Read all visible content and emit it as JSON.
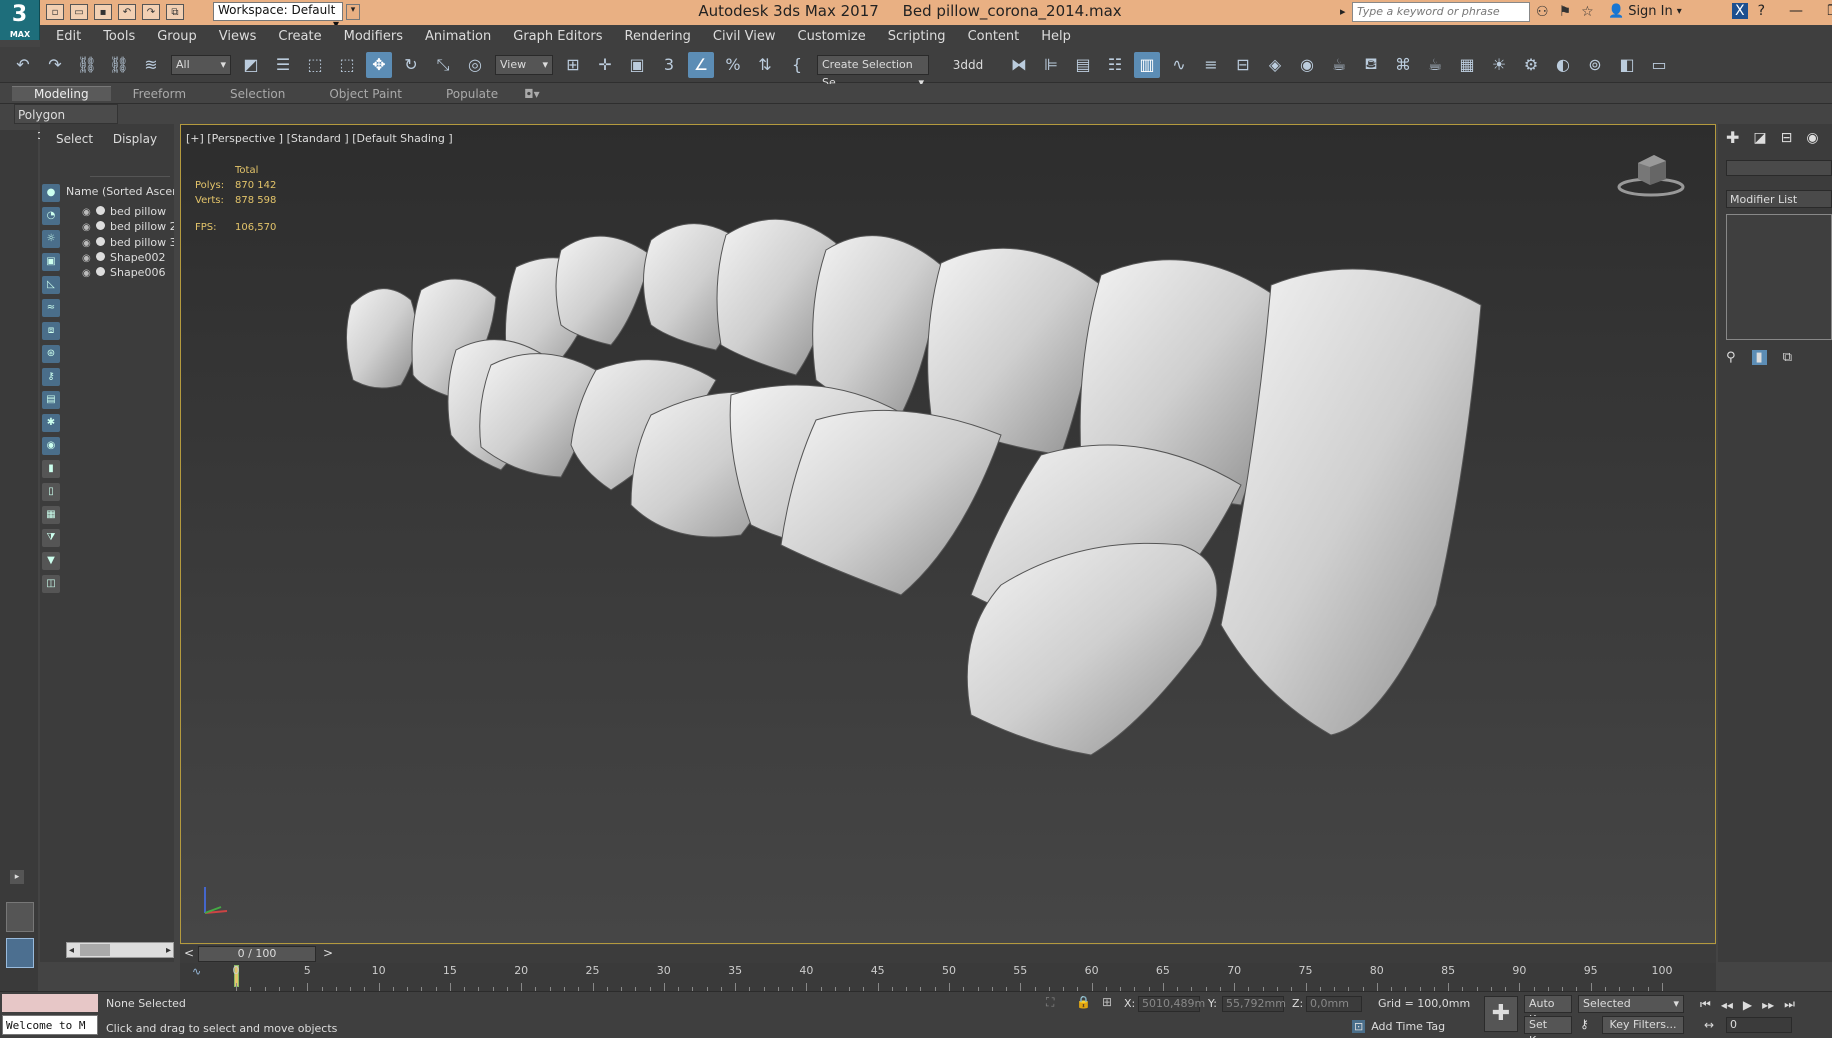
{
  "app": {
    "logo": "3",
    "logo_sub": "MAX",
    "title": "Autodesk 3ds Max 2017",
    "file": "Bed pillow_corona_2014.max"
  },
  "workspace": "Workspace: Default",
  "search_placeholder": "Type a keyword or phrase",
  "signin": "Sign In",
  "menu": [
    "Edit",
    "Tools",
    "Group",
    "Views",
    "Create",
    "Modifiers",
    "Animation",
    "Graph Editors",
    "Rendering",
    "Civil View",
    "Customize",
    "Scripting",
    "Content",
    "Help"
  ],
  "toolbar": {
    "filter": "All",
    "ref_coord": "View",
    "selection_set": "Create Selection Se",
    "label_3ddd": "3ddd"
  },
  "ribbon_tabs": [
    "Modeling",
    "Freeform",
    "Selection",
    "Object Paint",
    "Populate"
  ],
  "ribbon_panel": "Polygon Modeling",
  "explorer": {
    "tabs": [
      "Select",
      "Display"
    ],
    "column_header": "Name (Sorted Ascending)",
    "items": [
      "bed pillow",
      "bed pillow 2",
      "bed pillow 3",
      "Shape002",
      "Shape006"
    ]
  },
  "viewport": {
    "label": "[+] [Perspective ] [Standard ] [Default Shading ]",
    "stats": {
      "total_label": "Total",
      "polys_label": "Polys:",
      "polys": "870 142",
      "verts_label": "Verts:",
      "verts": "878 598",
      "fps_label": "FPS:",
      "fps": "106,570"
    }
  },
  "command_panel": {
    "modifier_list": "Modifier List"
  },
  "timeline": {
    "frame": "0 / 100",
    "labels": [
      "0",
      "5",
      "10",
      "15",
      "20",
      "25",
      "30",
      "35",
      "40",
      "45",
      "50",
      "55",
      "60",
      "65",
      "70",
      "75",
      "80",
      "85",
      "90",
      "95",
      "100"
    ]
  },
  "status": {
    "maxscript": "Welcome to M",
    "selection": "None Selected",
    "prompt": "Click and drag to select and move objects",
    "x_label": "X:",
    "x": "5010,489m",
    "y_label": "Y:",
    "y": "55,792mm",
    "z_label": "Z:",
    "z": "0,0mm",
    "grid": "Grid = 100,0mm",
    "add_time_tag": "Add Time Tag",
    "auto_key": "Auto Key",
    "set_key": "Set Key",
    "key_mode": "Selected",
    "key_filters": "Key Filters...",
    "current_frame": "0"
  }
}
